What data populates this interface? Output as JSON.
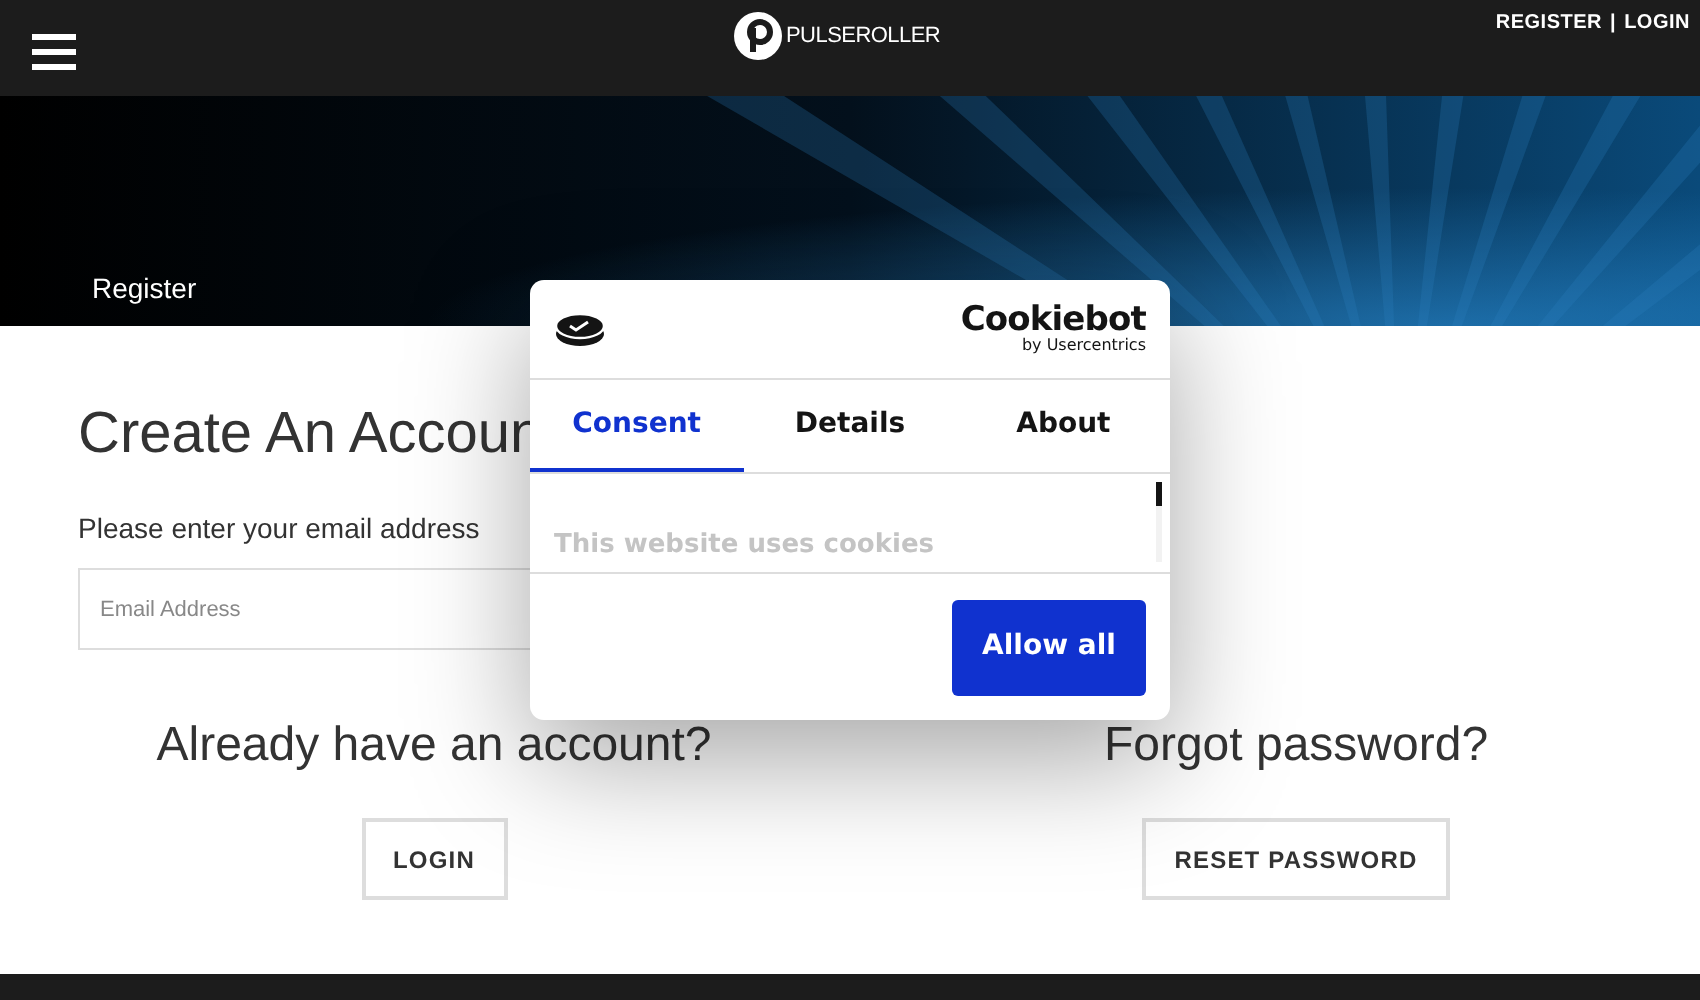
{
  "header": {
    "logo_text": "PULSEROLLER",
    "links": [
      "REGISTER",
      "LOGIN"
    ],
    "separator": "|"
  },
  "hero": {
    "breadcrumb": "Register"
  },
  "create": {
    "title": "Create An Accoun",
    "label": "Please enter your email address",
    "placeholder": "Email Address"
  },
  "login_section": {
    "title": "Already have an account?",
    "button": "LOGIN"
  },
  "reset_section": {
    "title": "Forgot password?",
    "button": "RESET PASSWORD"
  },
  "cookie_dialog": {
    "brand": "Cookiebot",
    "brand_sub": "by Usercentrics",
    "tabs": [
      {
        "label": "Consent",
        "selected": true
      },
      {
        "label": "Details",
        "selected": false
      },
      {
        "label": "About",
        "selected": false
      }
    ],
    "body_text": "This website uses cookies",
    "button": "Allow all"
  }
}
